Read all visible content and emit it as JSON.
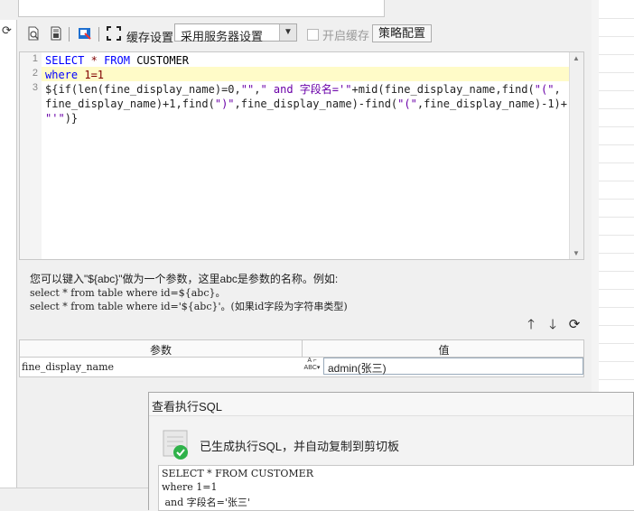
{
  "toolbar": {
    "cache_label": "缓存设置",
    "cache_mode_selected": "采用服务器设置",
    "enable_cache_label": "开启缓存",
    "enable_cache_checked": false,
    "strategy_button": "策略配置"
  },
  "editor": {
    "line_numbers": [
      "1",
      "2",
      "3"
    ],
    "lines": [
      "SELECT * FROM CUSTOMER",
      "where 1=1",
      "${if(len(fine_display_name)=0,\"\",\" and 字段名='\"+mid(fine_display_name,find(\"(\",",
      "fine_display_name)+1,find(\")\",fine_display_name)-find(\"(\",fine_display_name)-1)+",
      "\"'\")}"
    ]
  },
  "help": {
    "line1": "您可以键入\"${abc}\"做为一个参数，这里abc是参数的名称。例如:",
    "line2": "select * from table where id=${abc}。",
    "line3": "select * from table where id='${abc}'。(如果id字段为字符串类型)"
  },
  "params": {
    "header_name": "参数",
    "header_value": "值",
    "rows": [
      {
        "name": "fine_display_name",
        "value": "admin(张三)"
      }
    ]
  },
  "dialog": {
    "title": "查看执行SQL",
    "message": "已生成执行SQL，并自动复制到剪切板",
    "sql_lines": [
      "SELECT * FROM CUSTOMER",
      "where 1=1",
      " and 字段名='张三'"
    ]
  }
}
